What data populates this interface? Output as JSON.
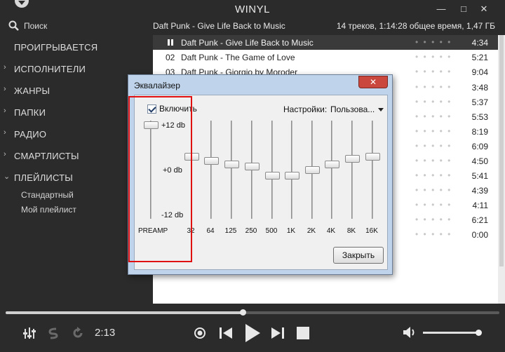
{
  "window": {
    "title": "WINYL",
    "minimize_glyph": "—",
    "maximize_glyph": "□",
    "close_glyph": "✕"
  },
  "header": {
    "search_label": "Поиск",
    "now_playing": "Daft Punk - Give Life Back to Music",
    "stats": "14 треков, 1:14:28 общее время, 1,47 ГБ"
  },
  "sidebar": {
    "items": [
      {
        "label": "ПРОИГРЫВАЕТСЯ",
        "chevron": ""
      },
      {
        "label": "ИСПОЛНИТЕЛИ",
        "chevron": "›"
      },
      {
        "label": "ЖАНРЫ",
        "chevron": "›"
      },
      {
        "label": "ПАПКИ",
        "chevron": "›"
      },
      {
        "label": "РАДИО",
        "chevron": "›"
      },
      {
        "label": "СМАРТЛИСТЫ",
        "chevron": "›"
      },
      {
        "label": "ПЛЕЙЛИСТЫ",
        "chevron": "⌄"
      }
    ],
    "playlists": [
      "Стандартный",
      "Мой плейлист"
    ]
  },
  "tracks": [
    {
      "num": "",
      "title": "Daft Punk - Give Life Back to Music",
      "duration": "4:34",
      "rating": "• • • • •"
    },
    {
      "num": "02",
      "title": "Daft Punk - The Game of Love",
      "duration": "5:21",
      "rating": "• • • • •"
    },
    {
      "num": "03",
      "title": "Daft Punk - Giorgio by Moroder",
      "duration": "9:04",
      "rating": "• • • • •"
    },
    {
      "num": "",
      "title": "",
      "duration": "3:48",
      "rating": "• • • • •"
    },
    {
      "num": "",
      "title": "",
      "duration": "5:37",
      "rating": "• • • • •"
    },
    {
      "num": "",
      "title": "",
      "duration": "5:53",
      "rating": "• • • • •"
    },
    {
      "num": "",
      "title": "",
      "duration": "8:19",
      "rating": "• • • • •"
    },
    {
      "num": "",
      "title": "",
      "duration": "6:09",
      "rating": "• • • • •"
    },
    {
      "num": "",
      "title": "",
      "duration": "4:50",
      "rating": "• • • • •"
    },
    {
      "num": "",
      "title": "",
      "duration": "5:41",
      "rating": "• • • • •"
    },
    {
      "num": "",
      "title": "",
      "duration": "4:39",
      "rating": "• • • • •"
    },
    {
      "num": "",
      "title": "",
      "duration": "4:11",
      "rating": "• • • • •"
    },
    {
      "num": "",
      "title": "",
      "duration": "6:21",
      "rating": "• • • • •"
    },
    {
      "num": "",
      "title": "",
      "duration": "0:00",
      "rating": "• • • • •"
    }
  ],
  "player": {
    "elapsed": "2:13",
    "progress_fraction": 0.48,
    "volume_fraction": 0.96,
    "icons": [
      "equalizer-icon",
      "shuffle-icon",
      "repeat-icon",
      "stop-after-icon",
      "previous-icon",
      "play-icon",
      "next-icon",
      "stop-icon",
      "volume-icon"
    ]
  },
  "equalizer": {
    "title": "Эквалайзер",
    "enable_label": "Включить",
    "enabled": true,
    "settings_label": "Настройки:",
    "preset_value": "Пользова...",
    "db_top": "+12 db",
    "db_mid": "+0 db",
    "db_bottom": "-12 db",
    "preamp_label": "PREAMP",
    "preamp_db": 12,
    "bands": [
      {
        "label": "32",
        "db": 3.5
      },
      {
        "label": "64",
        "db": 2.5
      },
      {
        "label": "125",
        "db": 1.5
      },
      {
        "label": "250",
        "db": 1
      },
      {
        "label": "500",
        "db": -1.5
      },
      {
        "label": "1K",
        "db": -1.5
      },
      {
        "label": "2K",
        "db": 0
      },
      {
        "label": "4K",
        "db": 1.5
      },
      {
        "label": "8K",
        "db": 3
      },
      {
        "label": "16K",
        "db": 3.5
      }
    ],
    "close_button": "Закрыть"
  },
  "colors": {
    "background": "#2b2b2b",
    "list_background": "#ffffff",
    "active_row": "#3a3a3a",
    "highlight": "#e01010",
    "dialog_frame": "#bfd3ea"
  }
}
